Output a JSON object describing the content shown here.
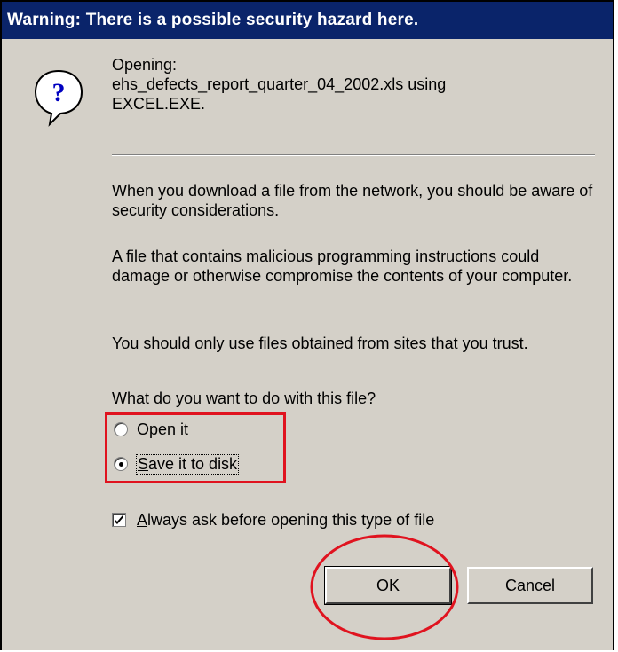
{
  "dialog": {
    "title": "Warning:  There is a possible security hazard here.",
    "icon": "question-icon",
    "opening_label": "Opening:",
    "file_line": "ehs_defects_report_quarter_04_2002.xls using",
    "program": "EXCEL.EXE.",
    "para1": "When you download a file from the network, you should be aware of security considerations.",
    "para2": "A file that contains malicious programming instructions could damage or otherwise compromise the contents of your computer.",
    "para3": "You should only use files obtained from sites that you trust.",
    "question": "What do you want to do with this file?",
    "options": [
      {
        "accel": "O",
        "rest": "pen it",
        "selected": false
      },
      {
        "accel": "S",
        "rest": "ave it to disk",
        "selected": true
      }
    ],
    "always_ask": {
      "accel": "A",
      "rest": "lways ask before opening this type of file",
      "checked": true
    },
    "ok_label": "OK",
    "cancel_label": "Cancel"
  },
  "colors": {
    "title_bg": "#0a246a",
    "dialog_bg": "#d4d0c8",
    "annotation_red": "#e0131f"
  }
}
